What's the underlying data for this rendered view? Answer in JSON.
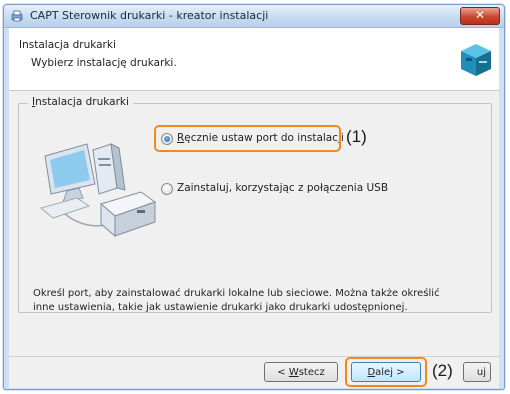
{
  "window": {
    "title": "CAPT Sterownik drukarki - kreator instalacji",
    "close_label": "✕"
  },
  "header": {
    "title": "Instalacja drukarki",
    "subtitle": "Wybierz instalację drukarki."
  },
  "group": {
    "title_accel": "I",
    "title_rest": "nstalacja drukarki"
  },
  "options": [
    {
      "label_accel": "R",
      "label_rest": "ęcznie ustaw port do instalacji",
      "selected": true
    },
    {
      "label": "Zainstaluj, korzystając z połączenia USB",
      "selected": false
    }
  ],
  "description": "Określ port, aby zainstalować drukarki lokalne lub sieciowe. Można także określić inne ustawienia, takie jak ustawienie drukarki jako drukarki udostępnionej.",
  "buttons": {
    "back_prefix": "< ",
    "back_accel": "W",
    "back_rest": "stecz",
    "next_accel": "D",
    "next_rest": "alej >",
    "cancel_visible": "uj"
  },
  "callouts": {
    "one": "(1)",
    "two": "(2)"
  },
  "colors": {
    "callout": "#f08a1c",
    "titlebar": "#c5daf1",
    "close": "#c9472f"
  }
}
